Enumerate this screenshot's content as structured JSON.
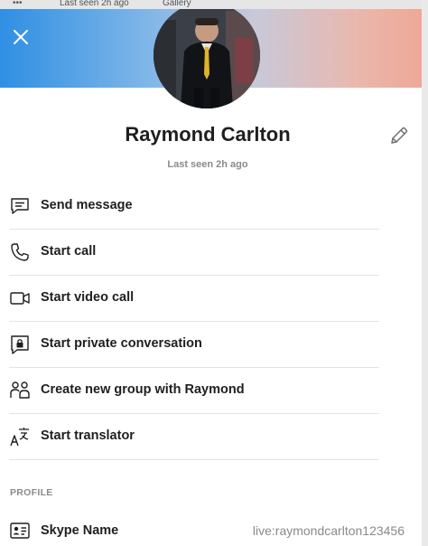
{
  "background_app": {
    "status_text": "Last seen 2h ago",
    "gallery_label": "Gallery",
    "menu_glyph": "•••"
  },
  "profile": {
    "name": "Raymond Carlton",
    "last_seen": "Last seen 2h ago"
  },
  "actions": [
    {
      "label": "Send message",
      "icon": "chat-icon"
    },
    {
      "label": "Start call",
      "icon": "phone-icon"
    },
    {
      "label": "Start video call",
      "icon": "video-camera-icon"
    },
    {
      "label": "Start private conversation",
      "icon": "lock-chat-icon"
    },
    {
      "label": "Create new group with Raymond",
      "icon": "group-icon"
    },
    {
      "label": "Start translator",
      "icon": "translate-icon"
    }
  ],
  "profile_section": {
    "title": "PROFILE",
    "skype_name_label": "Skype Name",
    "skype_name_value": "live:raymondcarlton123456"
  },
  "colors": {
    "banner_left": "#2f8fe3",
    "banner_right": "#efa896",
    "text_primary": "#1f1f1f",
    "text_secondary": "#8a8a8a"
  }
}
